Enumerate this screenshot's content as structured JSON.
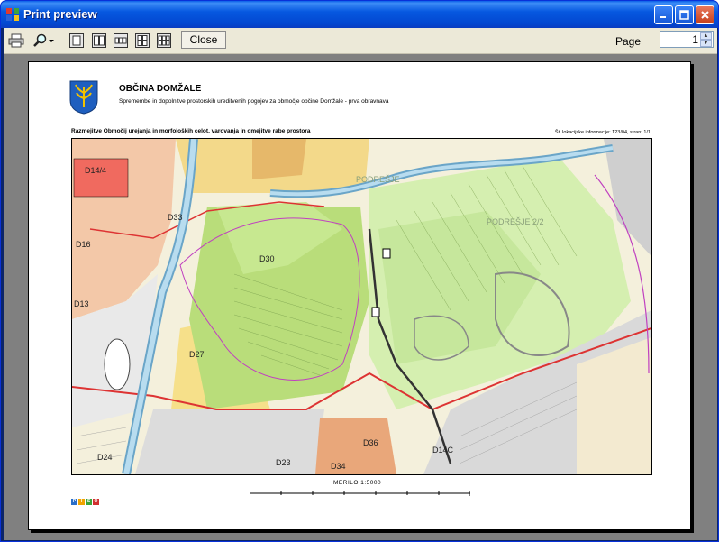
{
  "window": {
    "title": "Print preview"
  },
  "title_buttons": {
    "minimize": "_",
    "maximize": "□",
    "close": "✕"
  },
  "toolbar": {
    "close_label": "Close",
    "page_label": "Page",
    "page_value": "1"
  },
  "page": {
    "org_name": "OBČINA DOMŽALE",
    "org_subtitle": "Spremembe in dopolnitve prostorskih ureditvenih pogojev za območje občine Domžale - prva obravnava",
    "map_title": "Razmejitve Območij urejanja in morfoloških celot, varovanja in omejitve rabe prostora",
    "map_info": "Št. lokacijske informacije: 123/04, stran: 1/1",
    "scale_label": "MERILO 1:5000",
    "brand": [
      "P",
      "I",
      "S",
      "O"
    ],
    "brand_colors": [
      "#2a6fc9",
      "#f0a400",
      "#3aa43a",
      "#d03030"
    ],
    "map_labels": [
      "D14/4",
      "D16",
      "D13",
      "D33",
      "D30",
      "D27",
      "D24",
      "D23",
      "D36",
      "D34",
      "D14C",
      "PODREŠJE",
      "PODREŠJE 2/2"
    ]
  }
}
